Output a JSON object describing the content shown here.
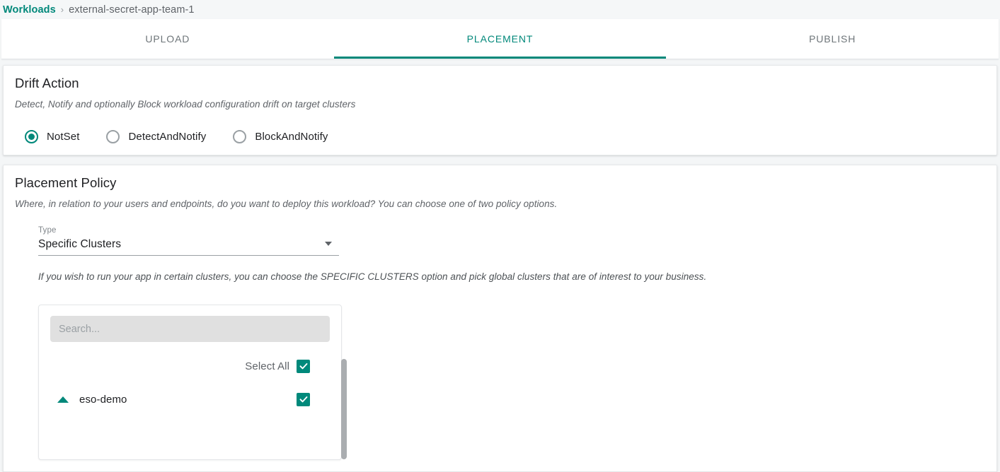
{
  "breadcrumb": {
    "root_label": "Workloads",
    "separator": "›",
    "current_label": "external-secret-app-team-1"
  },
  "tabs": [
    {
      "label": "UPLOAD",
      "active": false
    },
    {
      "label": "PLACEMENT",
      "active": true
    },
    {
      "label": "PUBLISH",
      "active": false
    }
  ],
  "drift_action": {
    "title": "Drift Action",
    "description": "Detect, Notify and optionally Block workload configuration drift on target clusters",
    "options": [
      {
        "label": "NotSet",
        "selected": true
      },
      {
        "label": "DetectAndNotify",
        "selected": false
      },
      {
        "label": "BlockAndNotify",
        "selected": false
      }
    ]
  },
  "placement_policy": {
    "title": "Placement Policy",
    "description": "Where, in relation to your users and endpoints, do you want to deploy this workload? You can choose one of two policy options.",
    "type_field": {
      "label": "Type",
      "value": "Specific Clusters",
      "caret_icon": "chevron-down-icon"
    },
    "hint": "If you wish to run your app in certain clusters, you can choose the SPECIFIC CLUSTERS option and pick global clusters that are of interest to your business.",
    "cluster_picker": {
      "search_placeholder": "Search...",
      "search_value": "",
      "search_icon": "search-icon",
      "select_all": {
        "label": "Select All",
        "checked": true
      },
      "clusters": [
        {
          "name": "eso-demo",
          "checked": true,
          "expanded": true,
          "expand_icon": "triangle-up-icon"
        }
      ]
    }
  },
  "colors": {
    "accent": "#00887a",
    "checkbox": "#00897b",
    "page_bg": "#f4f6f7",
    "text_primary": "#202124",
    "text_muted": "#5f6368"
  }
}
